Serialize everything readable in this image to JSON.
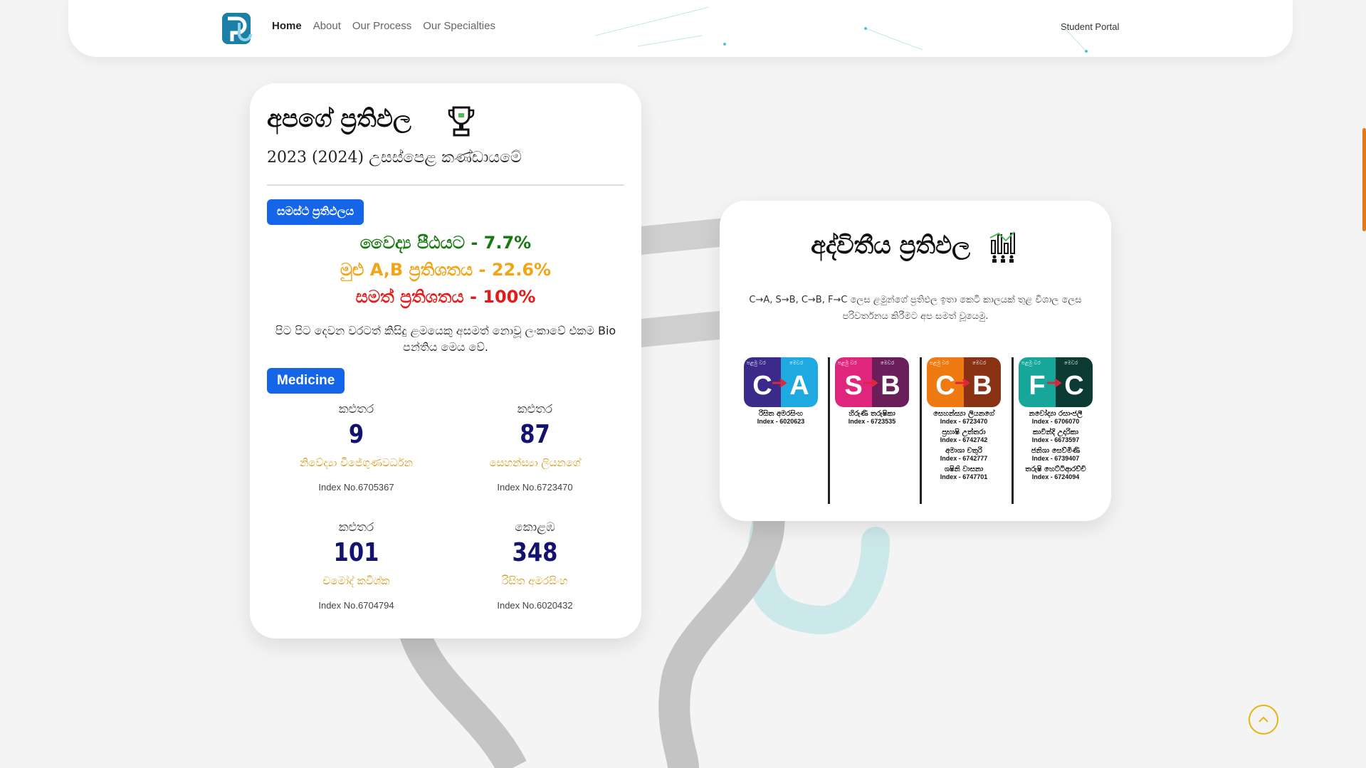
{
  "nav": {
    "logo_icon": "brand-logo-icon",
    "links": [
      "Home",
      "About",
      "Our Process",
      "Our Specialties"
    ],
    "portal": "Student Portal"
  },
  "overall_card": {
    "title": "අපගේ ප්‍රතිඵල",
    "trophy_icon": "trophy-icon",
    "subtitle": "2023 (2024) උසස්පෙළ කණ්ඩායමේ",
    "overall_badge": "සමස්ථ ප්‍රතිඵලය",
    "stats": [
      "වෛද්‍ය පීඨයට - 7.7%",
      "මුළු A,B ප්‍රතිශතය - 22.6%",
      "සමත් ප්‍රතිශතය - 100%"
    ],
    "description": "පිට පිට දෙවන වරටත් කිසිදු ළමයෙකු අසමත් නොවූ ලංකාවේ එකම Bio පන්තිය මෙය වේ.",
    "medicine_badge": "Medicine",
    "results": [
      {
        "city": "කළුතර",
        "rank": "9",
        "name": "නිවේද්‍යා විජේගුණවර්ධන",
        "index": "Index No.6705367"
      },
      {
        "city": "කළුතර",
        "rank": "87",
        "name": "සෙහන්ස්‍යා ලියනගේ",
        "index": "Index No.6723470"
      },
      {
        "city": "කළුතර",
        "rank": "101",
        "name": "චමෝද් කවිශ්ක",
        "index": "Index No.6704794"
      },
      {
        "city": "කොළඹ",
        "rank": "348",
        "name": "රිසිත අමරසිංහ",
        "index": "Index No.6020432"
      }
    ]
  },
  "unique_card": {
    "title": "අද්විතීය ප්‍රතිඵල",
    "chart_icon": "bar-chart-people-icon",
    "description": "C→A, S→B, C→B, F→C ලෙස ළමුන්ගේ ප්‍රතිඵල ඉතා කෙටි කාලයක් තුළ විශාල ලෙස පරිවර්තනය කිරීමට අප සමත් වූයෙමු.",
    "tag_first": "පළමු වර",
    "tag_now": "මෙවර",
    "groups": [
      {
        "from": "C",
        "to": "A",
        "from_color": "#3b2a8a",
        "to_color": "#1fa9e1",
        "students": [
          {
            "name": "රිසිත අමරසිංහ",
            "index": "Index - 6020623"
          }
        ]
      },
      {
        "from": "S",
        "to": "B",
        "from_color": "#e0267c",
        "to_color": "#6a1f5a",
        "students": [
          {
            "name": "හිරුණි තරුෂිකා",
            "index": "Index - 6723535"
          }
        ]
      },
      {
        "from": "C",
        "to": "B",
        "from_color": "#f07a12",
        "to_color": "#8a3214",
        "students": [
          {
            "name": "සෙහන්ස්‍යා ලියනගේ",
            "index": "Index - 6723470"
          },
          {
            "name": "ප්‍රභාෂි උත්තරා",
            "index": "Index - 6742742"
          },
          {
            "name": "අමාශා චතුරි",
            "index": "Index - 6742777"
          },
          {
            "name": "ශෂිනි වාසනා",
            "index": "Index - 6747701"
          }
        ]
      },
      {
        "from": "F",
        "to": "C",
        "from_color": "#16a69a",
        "to_color": "#0c3b34",
        "students": [
          {
            "name": "නවෝද්‍යා රසාංජලී",
            "index": "Index - 6706070"
          },
          {
            "name": "කාවින්දි උදාරිකා",
            "index": "Index - 6673597"
          },
          {
            "name": "ජනිශා සෙව්මිණි",
            "index": "Index - 6739407"
          },
          {
            "name": "තරුෂි හෙට්ටිආරච්චි",
            "index": "Index - 6724094"
          }
        ]
      }
    ]
  },
  "scroll_top_icon": "chevron-up-icon"
}
